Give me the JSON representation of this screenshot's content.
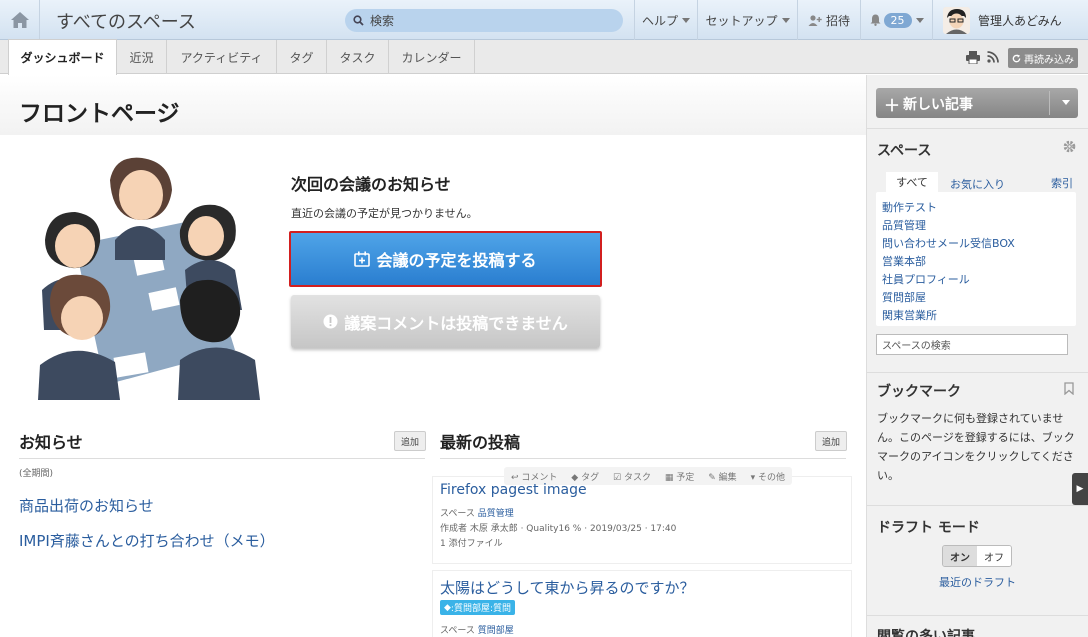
{
  "header": {
    "title": "すべてのスペース",
    "search_placeholder": "検索",
    "menu": {
      "help": "ヘルプ",
      "setup": "セットアップ",
      "invite": "招待",
      "notifications": "25",
      "user": "管理人あどみん"
    }
  },
  "tabs": [
    "ダッシュボード",
    "近況",
    "アクティビティ",
    "タグ",
    "タスク",
    "カレンダー"
  ],
  "reload_label": "再読み込み",
  "page_title": "フロントページ",
  "meeting": {
    "title": "次回の会議のお知らせ",
    "text": "直近の会議の予定が見つかりません。",
    "post_button": "会議の予定を投稿する",
    "no_comment_button": "議案コメントは投稿できません"
  },
  "news": {
    "title": "お知らせ",
    "add": "追加",
    "period": "(全期間)",
    "items": [
      "商品出荷のお知らせ",
      "IMPI斉藤さんとの打ち合わせ（メモ）"
    ]
  },
  "latest": {
    "title": "最新の投稿",
    "add": "追加",
    "actions": [
      "コメント",
      "タグ",
      "タスク",
      "予定",
      "編集",
      "その他"
    ],
    "posts": [
      {
        "title": "Firefox pagest image",
        "space_label": "スペース",
        "space": "品質管理",
        "byline": "作成者 木原 承太郎 · Quality16",
        "date": "· 2019/03/25 · 17:40",
        "attachments": "1 添付ファイル"
      },
      {
        "title": "太陽はどうして東から昇るのですか？",
        "tag": ":質問部屋:質問",
        "space_label": "スペース",
        "space": "質問部屋"
      }
    ]
  },
  "sidebar": {
    "new_post": "新しい記事",
    "spaces_title": "スペース",
    "spaces_tabs": [
      "すべて",
      "お気に入り"
    ],
    "index": "索引",
    "spaces": [
      "動作テスト",
      "品質管理",
      "問い合わせメール受信BOX",
      "営業本部",
      "社員プロフィール",
      "質問部屋",
      "関東営業所"
    ],
    "space_search": "スペースの検索",
    "bookmark_title": "ブックマーク",
    "bookmark_text": "ブックマークに何も登録されていません。このページを登録するには、ブックマークのアイコンをクリックしてください。",
    "draft_title": "ドラフト モード",
    "draft_on": "オン",
    "draft_off": "オフ",
    "recent_drafts": "最近のドラフト",
    "popular_title": "閲覧の多い記事"
  },
  "colors": {
    "primary_button": "#2a7ed0",
    "highlight_border": "#d21f1f",
    "link": "#2a5d9e",
    "tag": "#3ab3e8"
  }
}
